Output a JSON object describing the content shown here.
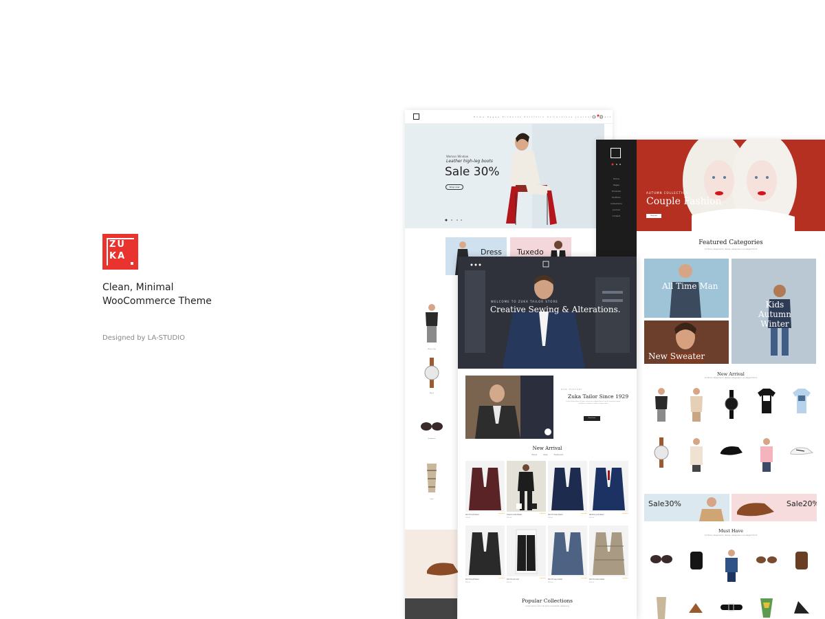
{
  "brand": {
    "logo_line1": "ZU",
    "logo_line2": "KA",
    "tagline_line1": "Clean, Minimal",
    "tagline_line2": "WooCommerce Theme",
    "credit": "Designed by LA-STUDIO",
    "accent": "#e8332f"
  },
  "mockup_left": {
    "nav_text": "Home  Pages  Products  Portfolio  Collections  Journal  Contact",
    "hero_kicker": "Woman Window",
    "hero_sub": "Leather high-leg boots",
    "hero_big": "Sale 30%",
    "hero_button": "Shop now",
    "card_dress": "Dress",
    "card_tuxedo": "Tuxedo",
    "products": [
      "Women Top",
      "Watch",
      "Sunglasses",
      "Scarf"
    ]
  },
  "mockup_right": {
    "side_menu": [
      "Home",
      "Pages",
      "Products",
      "Portfolio",
      "Collections",
      "Journal",
      "Contact"
    ],
    "hero_kicker": "AUTUMN COLLECTION",
    "hero_title": "Couple Fashion",
    "hero_button": "Shop now",
    "featured_title": "Featured Categories",
    "featured_sub": "Combine categories to display categories in an elegant block",
    "cats": [
      "All Time Man",
      "Kids Autumn Winter",
      "New Sweater"
    ],
    "new_arrival_title": "New Arrival",
    "new_arrival_sub": "Combine categories to display categories in an elegant block",
    "promo1": "Sale30%",
    "promo2": "Sale20%",
    "must_have_title": "Must Have",
    "must_have_sub": "Combine categories to display categories in an elegant block"
  },
  "mockup_center": {
    "hero_kicker": "WELCOME TO ZUKA TAILOR STORE",
    "hero_title": "Creative Sewing & Alterations.",
    "tailor_kicker": "OUR HISTORY",
    "tailor_title": "Zuka Tailor Since 1929",
    "tailor_para": "Lorem ipsum dolor sit amet consectetur adipiscing elit sed do eiusmod tempor incididunt ut labore et dolore magna aliqua",
    "tailor_button": "Read more",
    "new_arrival_title": "New Arrival",
    "tabs": [
      "Trend",
      "Sale",
      "Featured"
    ],
    "products": [
      {
        "name": "Slim fit suit blazer",
        "price": "$99.00"
      },
      {
        "name": "Tuxedo Collar Blazer",
        "price": "$99.00"
      },
      {
        "name": "Slim fit dress blazer",
        "price": "$99.00"
      },
      {
        "name": "Wedding suit blazer",
        "price": "$99.00"
      },
      {
        "name": "Slim fit suit blazer",
        "price": "$99.00"
      },
      {
        "name": "Slim fit suit vest",
        "price": "$99.00"
      },
      {
        "name": "Slim fit navy blazer",
        "price": "$99.00"
      },
      {
        "name": "Slim fit check blazer",
        "price": "$99.00"
      }
    ],
    "popular_title": "Popular Collections",
    "popular_sub": "Lorem ipsum dolor sit amet consectetur adipiscing"
  }
}
